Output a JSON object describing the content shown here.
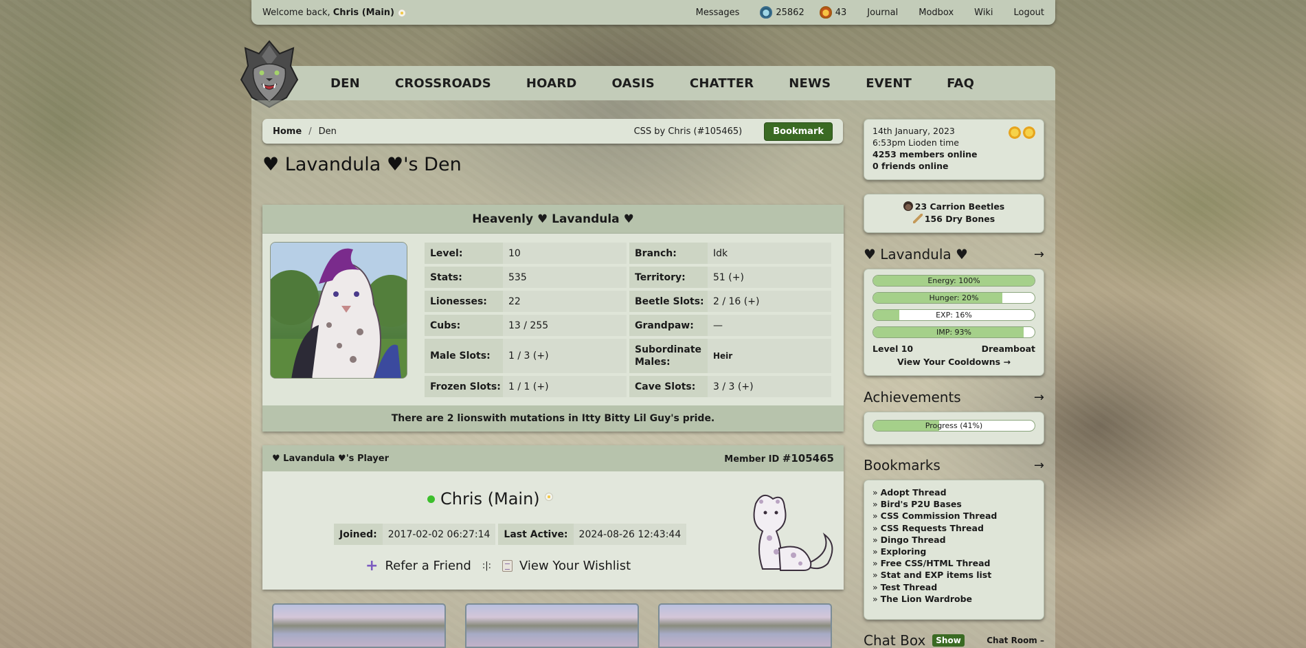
{
  "topbar": {
    "welcome_prefix": "Welcome back, ",
    "user": "Chris (Main)",
    "messages": "Messages",
    "beetles": "25862",
    "gold_beetles": "43",
    "journal": "Journal",
    "modbox": "Modbox",
    "wiki": "Wiki",
    "logout": "Logout"
  },
  "nav": [
    "DEN",
    "CROSSROADS",
    "HOARD",
    "OASIS",
    "CHATTER",
    "NEWS",
    "EVENT",
    "FAQ"
  ],
  "breadcrumb": {
    "home": "Home",
    "sep": "/",
    "current": "Den",
    "css_credit": "CSS by Chris (#105465)",
    "bookmark": "Bookmark"
  },
  "page_title": "♥ Lavandula ♥'s Den",
  "pride": {
    "title": "Heavenly ♥ Lavandula ♥",
    "rows": [
      {
        "k1": "Level:",
        "v1": "10",
        "k2": "Branch:",
        "v2": "Idk"
      },
      {
        "k1": "Stats:",
        "v1": "535",
        "k2": "Territory:",
        "v2": "51 (+)"
      },
      {
        "k1": "Lionesses:",
        "v1": "22",
        "k2": "Beetle Slots:",
        "v2": "2 / 16 (+)"
      },
      {
        "k1": "Cubs:",
        "v1": "13 / 255",
        "k2": "Grandpaw:",
        "v2": "—"
      },
      {
        "k1": "Male Slots:",
        "v1": "1 / 3 (+)",
        "k2": "Subordinate Males:",
        "v2": "Heir"
      },
      {
        "k1": "Frozen Slots:",
        "v1": "1 / 1 (+)",
        "k2": "Cave Slots:",
        "v2": "3 / 3 (+)"
      }
    ],
    "footer_pre": "There are ",
    "footer_bold": "2 lions",
    "footer_post": " with mutations in Itty Bitty Lil Guy's pride."
  },
  "player": {
    "header": "♥ Lavandula ♥'s Player",
    "member_label": "Member ID",
    "member_id": "#105465",
    "name": "Chris (Main)",
    "joined_label": "Joined:",
    "joined": "2017-02-02 06:27:14",
    "active_label": "Last Active:",
    "active": "2024-08-26 12:43:44",
    "refer": "Refer a Friend",
    "divider": ":|:",
    "wishlist": "View Your Wishlist"
  },
  "sidebar": {
    "date": "14th January, 2023",
    "time": "6:53pm Lioden time",
    "members_online": "4253 members online",
    "friends_online": "0 friends online",
    "item1": "23 Carrion Beetles",
    "item2": "156 Dry Bones",
    "lion_title": "♥ Lavandula ♥",
    "arrow": "→",
    "bars": [
      {
        "label": "Energy: 100%",
        "value": 1.0
      },
      {
        "label": "Hunger: 20%",
        "value": 0.8
      },
      {
        "label": "EXP: 16%",
        "value": 0.16
      },
      {
        "label": "IMP: 93%",
        "value": 0.93
      }
    ],
    "level": "Level 10",
    "dreamboat": "Dreamboat",
    "cooldowns": "View Your Cooldowns →",
    "ach_title": "Achievements",
    "progress": {
      "label": "Progress (41%)",
      "value": 0.41
    },
    "bookmarks_title": "Bookmarks",
    "bookmarks": [
      "Adopt Thread",
      "Bird's P2U Bases",
      "CSS Commission Thread",
      "CSS Requests Thread",
      "Dingo Thread",
      "Exploring",
      "Free CSS/HTML Thread",
      "Stat and EXP items list",
      "Test Thread",
      "The Lion Wardrobe"
    ],
    "chat_title": "Chat Box",
    "chat_show": "Show",
    "chat_room": "Chat Room –"
  },
  "colors": {
    "accent_green": "#3a6a23",
    "panel": "#dfe5d8",
    "header": "#b7c3ac",
    "bar_fill": "#a5d08a"
  }
}
